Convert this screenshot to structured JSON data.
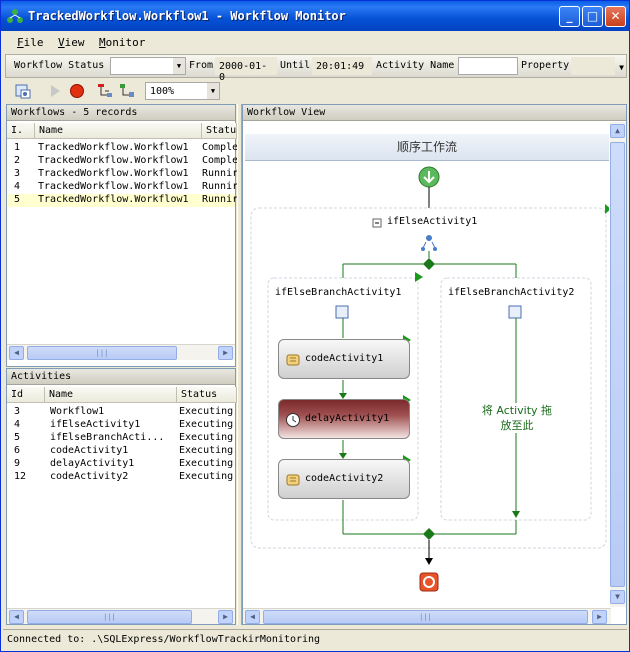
{
  "window": {
    "title": "TrackedWorkflow.Workflow1 - Workflow Monitor",
    "min_label": "_",
    "max_label": "□",
    "close_label": "✕"
  },
  "menu": {
    "file": "File",
    "file_key": "F",
    "file_rest": "ile",
    "view": "View",
    "view_key": "V",
    "view_rest": "iew",
    "monitor": "Monitor",
    "monitor_key": "M",
    "monitor_rest": "onitor"
  },
  "filter": {
    "workflow_status_label": "Workflow Status",
    "workflow_status_value": "",
    "from_label": "From",
    "from_value": "2000-01-0",
    "until_label": "Until",
    "until_value": "20:01:49",
    "activity_name_label": "Activity Name",
    "activity_name_value": "",
    "property_label": "Property"
  },
  "toolbar": {
    "zoom": "100%"
  },
  "workflows": {
    "header": "Workflows - 5 records",
    "columns": [
      "I.",
      "Name",
      "Status"
    ],
    "rows": [
      {
        "id": "1",
        "name": "TrackedWorkflow.Workflow1",
        "status": "Comple"
      },
      {
        "id": "2",
        "name": "TrackedWorkflow.Workflow1",
        "status": "Comple"
      },
      {
        "id": "3",
        "name": "TrackedWorkflow.Workflow1",
        "status": "Runnir"
      },
      {
        "id": "4",
        "name": "TrackedWorkflow.Workflow1",
        "status": "Runnir"
      },
      {
        "id": "5",
        "name": "TrackedWorkflow.Workflow1",
        "status": "Runnir"
      }
    ],
    "scroll_mark": "|||"
  },
  "activities": {
    "header": "Activities",
    "columns": [
      "Id",
      "Name",
      "Status"
    ],
    "rows": [
      {
        "id": "3",
        "name": "Workflow1",
        "status": "Executing"
      },
      {
        "id": "4",
        "name": "ifElseActivity1",
        "status": "Executing"
      },
      {
        "id": "5",
        "name": "ifElseBranchActi...",
        "status": "Executing"
      },
      {
        "id": "6",
        "name": "codeActivity1",
        "status": "Executing"
      },
      {
        "id": "9",
        "name": "delayActivity1",
        "status": "Executing"
      },
      {
        "id": "12",
        "name": "codeActivity2",
        "status": "Executing"
      }
    ],
    "scroll_mark": "|||"
  },
  "workflow_view": {
    "header": "Workflow View",
    "sequential_title": "顺序工作流",
    "ifelse_name": "ifElseActivity1",
    "branch1": "ifElseBranchActivity1",
    "branch2": "ifElseBranchActivity2",
    "code1": "codeActivity1",
    "delay1": "delayActivity1",
    "code2": "codeActivity2",
    "drop_hint_line1": "将 Activity 拖",
    "drop_hint_line2": "放至此",
    "scroll_mark": "|||"
  },
  "status": {
    "text": "Connected to: .\\SQLExpress/WorkflowTrackirMonitoring"
  },
  "colors": {
    "title_blue": "#0551d6",
    "selection": "#ffffd0",
    "flow_green": "#1a7a1a"
  }
}
